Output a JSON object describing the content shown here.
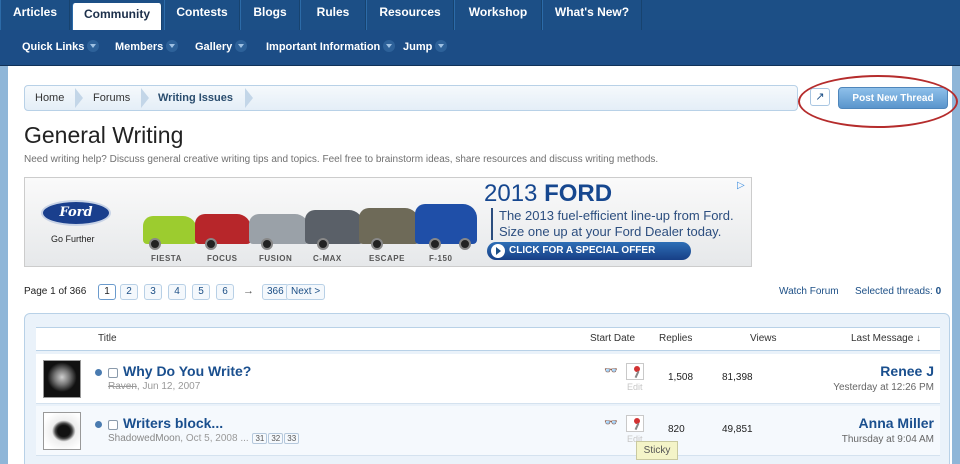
{
  "top_tabs": [
    {
      "label": "Articles"
    },
    {
      "label": "Community"
    },
    {
      "label": "Contests"
    },
    {
      "label": "Blogs"
    },
    {
      "label": "Rules"
    },
    {
      "label": "Resources"
    },
    {
      "label": "Workshop"
    },
    {
      "label": "What's New?"
    }
  ],
  "sub_nav": [
    "Quick Links",
    "Members",
    "Gallery",
    "Important Information",
    "Jump"
  ],
  "breadcrumb": [
    "Home",
    "Forums",
    "Writing Issues"
  ],
  "post_thread_label": "Post New Thread",
  "popout_icon": "↗",
  "page": {
    "title": "General Writing",
    "description": "Need writing help? Discuss general creative writing tips and topics. Feel free to brainstorm ideas, share resources and discuss writing methods."
  },
  "ad": {
    "brand": "Ford",
    "tagline": "Go Further",
    "models": [
      "FIESTA",
      "FOCUS",
      "FUSION",
      "C-MAX",
      "ESCAPE",
      "F-150"
    ],
    "headline_year": "2013",
    "headline_brand": "FORD",
    "copy_line1": "The 2013 fuel-efficient line-up from Ford.",
    "copy_line2": "Size one up at your Ford Dealer today.",
    "cta": "CLICK FOR A SPECIAL OFFER",
    "choice_icon": "▷"
  },
  "pagination": {
    "label": "Page 1 of 366",
    "pages": [
      "1",
      "2",
      "3",
      "4",
      "5",
      "6"
    ],
    "arrow": "→",
    "last": "366",
    "next": "Next >"
  },
  "watch_forum": "Watch Forum",
  "selected_threads_label": "Selected threads:",
  "selected_threads_count": "0",
  "columns": {
    "title": "Title",
    "start_date": "Start Date",
    "replies": "Replies",
    "views": "Views",
    "last_message": "Last Message ↓"
  },
  "threads": [
    {
      "title": "Why Do You Write?",
      "author": "Raven",
      "date": "Jun 12, 2007",
      "pages": [],
      "glasses": "👓",
      "edit": "Edit",
      "replies": "1,508",
      "views": "81,398",
      "last_user": "Renee J",
      "last_date": "Yesterday at 12:26 PM"
    },
    {
      "title": "Writers block...",
      "author": "ShadowedMoon",
      "date": "Oct 5, 2008",
      "ellipsis": "...",
      "pages": [
        "31",
        "32",
        "33"
      ],
      "glasses": "👓",
      "edit": "Edit",
      "replies": "820",
      "views": "49,851",
      "last_user": "Anna Miller",
      "last_date": "Thursday at 9:04 AM"
    }
  ],
  "tooltip": "Sticky"
}
